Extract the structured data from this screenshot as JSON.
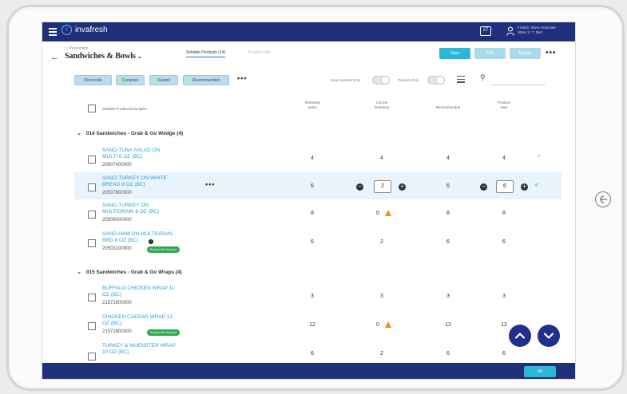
{
  "app": {
    "brand": "invafresh",
    "logo_letter": "i",
    "notifications": "27",
    "user_line1": "Frank2, Store Associate",
    "user_line2": "Store 1 / T. Diet"
  },
  "breadcrumb": "Production",
  "page_title": "Sandwiches & Bowls",
  "tabs": [
    {
      "label": "Sellable Products (14)"
    },
    {
      "label": "Product (48)"
    }
  ],
  "actions": {
    "save": "Save",
    "print": "Print",
    "details": "Details",
    "ok": "OK"
  },
  "chips": [
    "Reconcile",
    "Compare",
    "Submit",
    "Recommended"
  ],
  "toggles": {
    "unaccounted": "Unaccounted Only",
    "product": "Product Only"
  },
  "columns": {
    "product": "Sellable Product Description",
    "yesterday": [
      "Yesterday",
      "Sales"
    ],
    "current": [
      "Current",
      "Inventory"
    ],
    "recommended": "Recommended",
    "produce": [
      "Produce",
      "Now"
    ]
  },
  "groups": [
    {
      "title": "014 Sandwiches - Grab & Go Wedge (4)"
    },
    {
      "title": "015 Sandwiches - Grab & Go Wraps (4)"
    }
  ],
  "rows": [
    {
      "name": [
        "SAND-TUNA SALAD ON",
        "MULTI 6 OZ (BC)"
      ],
      "upc": "20507400000",
      "yesterday": "4",
      "current": "4",
      "recommended": "4",
      "produce": "4"
    },
    {
      "name": [
        "SAND-TURKEY ON WHITE",
        "BREAD 8 OZ (BC)"
      ],
      "upc": "20507800000",
      "yesterday": "6",
      "current": "2",
      "recommended": "6",
      "produce": "6"
    },
    {
      "name": [
        "SAND-TURKEY ON",
        "MULTIGRAIN 8 OZ (BC)"
      ],
      "upc": "20508000000",
      "yesterday": "8",
      "current": "0",
      "recommended": "8",
      "produce": "8"
    },
    {
      "name": [
        "SAND-HAM ON MULTIGRAIN",
        "BRD 8 OZ (BC)"
      ],
      "upc": "20503100000",
      "badge": "Ready-Print Wrap Ad",
      "yesterday": "6",
      "current": "2",
      "recommended": "6",
      "produce": "6"
    },
    {
      "name": [
        "BUFFALO CHICKEN WRAP 11",
        "OZ (BC)"
      ],
      "upc": "21572600000",
      "yesterday": "3",
      "current": "3",
      "recommended": "3",
      "produce": "3"
    },
    {
      "name": [
        "CHICKEN CAESAR WRAP 12",
        "OZ (BC)"
      ],
      "upc": "21572800000",
      "badge": "Ready-Print Wrap Ad",
      "yesterday": "12",
      "current": "0",
      "recommended": "12",
      "produce": "12"
    },
    {
      "name": [
        "TURKEY & MUENSTER WRAP",
        "10 OZ (BC)"
      ],
      "upc": "",
      "yesterday": "6",
      "current": "2",
      "recommended": "6",
      "produce": "6"
    }
  ],
  "icons": [
    "hamburger-icon",
    "chat-icon",
    "user-icon",
    "back-arrow-icon",
    "filter-icon",
    "search-icon",
    "warning-icon",
    "minus-icon",
    "plus-icon",
    "check-icon",
    "chevron-up-icon",
    "chevron-down-icon",
    "home-button-icon"
  ],
  "colors": {
    "nav": "#1f2f7a",
    "accent": "#2cb7d9",
    "link": "#2e9fd0",
    "warning": "#f28d2c",
    "badge": "#2fa84f"
  }
}
